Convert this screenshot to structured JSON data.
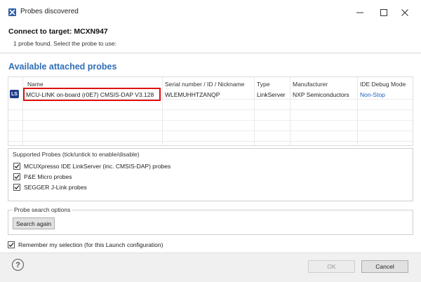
{
  "window": {
    "title": "Probes discovered",
    "minimize_glyph": "—",
    "maximize_glyph": "☐",
    "close_glyph": "✕"
  },
  "header": {
    "title": "Connect to target: MCXN947",
    "subtitle": "1 probe found. Select the probe to use:"
  },
  "probes": {
    "section_title": "Available attached probes",
    "columns": [
      "Name",
      "Serial number / ID / Nickname",
      "Type",
      "Manufacturer",
      "IDE Debug Mode"
    ],
    "rows": [
      {
        "badge": "LS",
        "name": "MCU-LINK on-board (r0E7) CMSIS-DAP V3.128",
        "serial": "WLEMUHHTZANQP",
        "type": "LinkServer",
        "manufacturer": "NXP Semiconductors",
        "debug_mode": "Non-Stop"
      }
    ]
  },
  "supported_probes": {
    "label": "Supported Probes (tick/untick to enable/disable)",
    "items": [
      {
        "label": "MCUXpresso IDE LinkServer (inc. CMSIS-DAP) probes",
        "checked": true
      },
      {
        "label": "P&E Micro probes",
        "checked": true
      },
      {
        "label": "SEGGER J-Link probes",
        "checked": true
      }
    ]
  },
  "search_options": {
    "label": "Probe search options",
    "search_button": "Search again"
  },
  "remember": {
    "label": "Remember my selection (for this Launch configuration)",
    "checked": true
  },
  "footer": {
    "help_glyph": "?",
    "ok_label": "OK",
    "cancel_label": "Cancel"
  },
  "colors": {
    "section_title": "#2e6eb5",
    "highlight_border": "#e01010",
    "link": "#1b5fc6",
    "badge_bg": "#1f3e8a"
  }
}
